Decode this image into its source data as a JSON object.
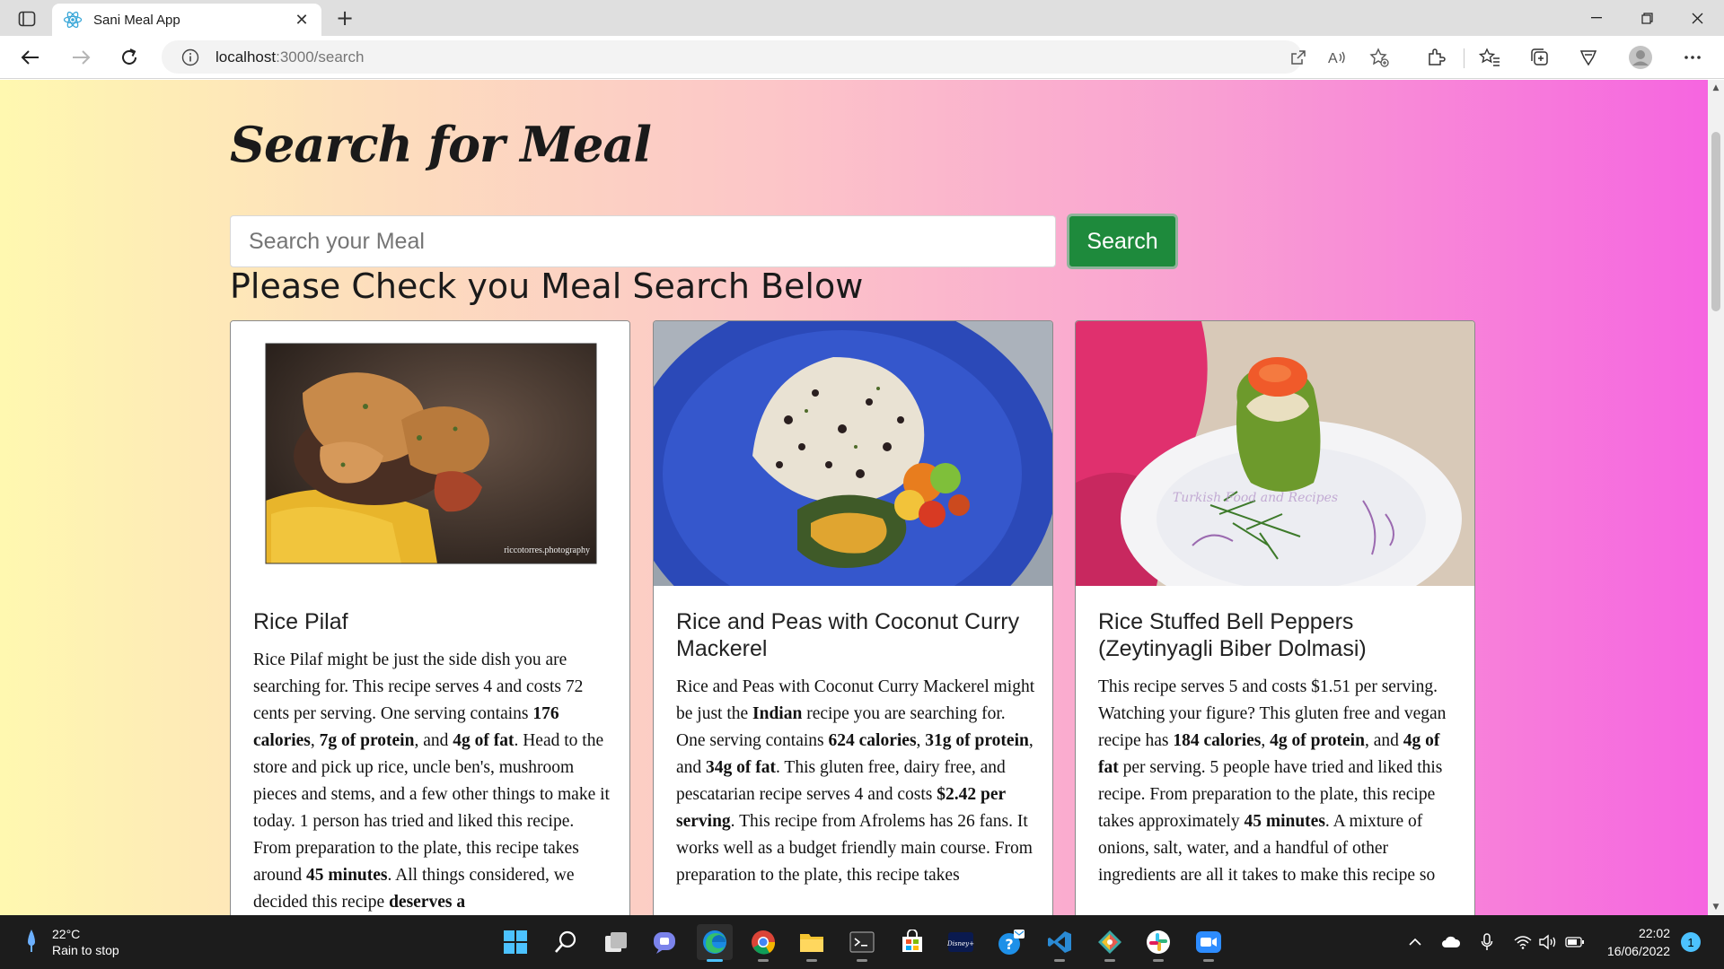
{
  "browser": {
    "tab_title": "Sani Meal App",
    "url_host": "localhost",
    "url_rest": ":3000/search"
  },
  "page": {
    "title": "Search for Meal",
    "search_placeholder": "Search your Meal",
    "search_button": "Search",
    "results_heading": "Please Check you Meal Search Below"
  },
  "cards": [
    {
      "title": "Rice Pilaf",
      "photo_credit": "riccotorres.photography",
      "summary": [
        {
          "t": "Rice Pilaf might be just the side dish you are searching for. This recipe serves 4 and costs 72 cents per serving. One serving contains "
        },
        {
          "t": "176 calories",
          "b": true
        },
        {
          "t": ", "
        },
        {
          "t": "7g of protein",
          "b": true
        },
        {
          "t": ", and "
        },
        {
          "t": "4g of fat",
          "b": true
        },
        {
          "t": ". Head to the store and pick up rice, uncle ben's, mushroom pieces and stems, and a few other things to make it today. 1 person has tried and liked this recipe. From preparation to the plate, this recipe takes around "
        },
        {
          "t": "45 minutes",
          "b": true
        },
        {
          "t": ". All things considered, we decided this recipe "
        },
        {
          "t": "deserves a",
          "b": true
        }
      ]
    },
    {
      "title": "Rice and Peas with Coconut Curry Mackerel",
      "summary": [
        {
          "t": "Rice and Peas with Coconut Curry Mackerel might be just the "
        },
        {
          "t": "Indian",
          "b": true
        },
        {
          "t": " recipe you are searching for. One serving contains "
        },
        {
          "t": "624 calories",
          "b": true
        },
        {
          "t": ", "
        },
        {
          "t": "31g of protein",
          "b": true
        },
        {
          "t": ", and "
        },
        {
          "t": "34g of fat",
          "b": true
        },
        {
          "t": ". This gluten free, dairy free, and pescatarian recipe serves 4 and costs "
        },
        {
          "t": "$2.42 per serving",
          "b": true
        },
        {
          "t": ". This recipe from Afrolems has 26 fans. It works well as a budget friendly main course. From preparation to the plate, this recipe takes"
        }
      ]
    },
    {
      "title": "Rice Stuffed Bell Peppers (Zeytinyagli Biber Dolmasi)",
      "photo_watermark": "Turkish Food and Recipes",
      "summary": [
        {
          "t": "This recipe serves 5 and costs $1.51 per serving. Watching your figure? This gluten free and vegan recipe has "
        },
        {
          "t": "184 calories",
          "b": true
        },
        {
          "t": ", "
        },
        {
          "t": "4g of protein",
          "b": true
        },
        {
          "t": ", and "
        },
        {
          "t": "4g of fat",
          "b": true
        },
        {
          "t": " per serving. 5 people have tried and liked this recipe. From preparation to the plate, this recipe takes approximately "
        },
        {
          "t": "45 minutes",
          "b": true
        },
        {
          "t": ". A mixture of onions, salt, water, and a handful of other ingredients are all it takes to make this recipe so"
        }
      ]
    }
  ],
  "taskbar": {
    "weather_temp": "22°C",
    "weather_desc": "Rain to stop",
    "time": "22:02",
    "date": "16/06/2022",
    "notification_count": "1"
  },
  "colors": {
    "search_button": "#1e8a3c",
    "gradient_start": "#fff8b0",
    "gradient_end": "#f665e0"
  }
}
